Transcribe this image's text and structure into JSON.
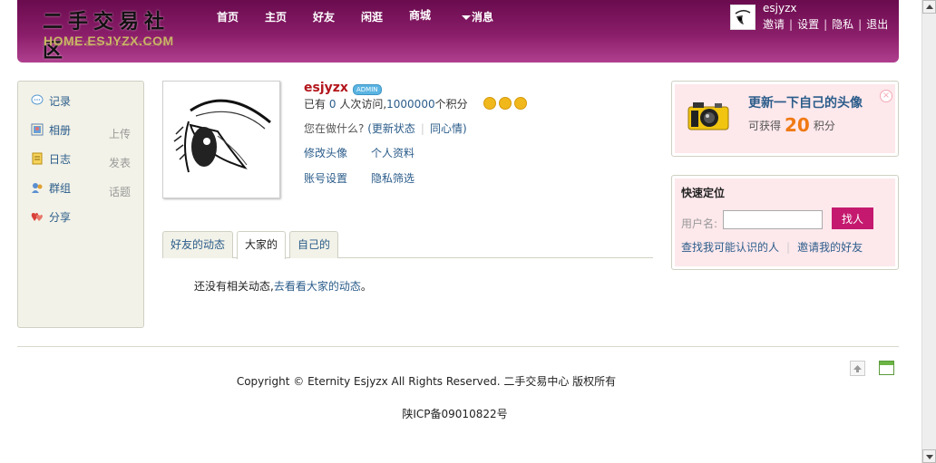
{
  "header": {
    "logo_cn": "二手交易社区",
    "logo_en": "HOME.ESJYZX.COM",
    "nav": [
      "首页",
      "主页",
      "好友",
      "闲逛",
      "商城",
      "消息"
    ],
    "username": "esjyzx",
    "user_links": [
      "邀请",
      "设置",
      "隐私",
      "退出"
    ]
  },
  "sidebar": {
    "items": [
      {
        "label": "记录",
        "extra": ""
      },
      {
        "label": "相册",
        "extra": "上传"
      },
      {
        "label": "日志",
        "extra": "发表"
      },
      {
        "label": "群组",
        "extra": "话题"
      },
      {
        "label": "分享",
        "extra": ""
      }
    ]
  },
  "profile": {
    "name": "esjyzx",
    "badge": "ADMIN",
    "visits_prefix": "已有",
    "visits": "0",
    "visits_mid": "人次访问,",
    "points": "1000000",
    "points_suffix": "个积分",
    "doing_prompt": "您在做什么?",
    "update_status": "(更新状态",
    "mood": "同心情)",
    "links": [
      "修改头像",
      "个人资料",
      "账号设置",
      "隐私筛选"
    ]
  },
  "tabs": [
    "好友的动态",
    "大家的",
    "自己的"
  ],
  "feed": {
    "empty_text": "还没有相关动态,",
    "empty_link": "去看看大家的动态",
    "empty_end": "。"
  },
  "avatar_prompt": {
    "title": "更新一下自己的头像",
    "earn_prefix": "可获得",
    "points": "20",
    "earn_suffix": "积分"
  },
  "quick_locate": {
    "title": "快速定位",
    "label": "用户名:",
    "input_value": "",
    "button": "找人",
    "links": [
      "查找我可能认识的人",
      "邀请我的好友"
    ]
  },
  "footer": {
    "copyright": "Copyright © Eternity Esjyzx All Rights Reserved. 二手交易中心 版权所有",
    "icp": "陕ICP备09010822号"
  },
  "colors": {
    "header_bg": "#8a1d69",
    "link": "#2b5c8a",
    "name": "#b3151b",
    "button": "#c4196e",
    "points_highlight": "#f07a14",
    "panel_bg": "#fde8ec",
    "sidebar_bg": "#f2f2e8"
  }
}
